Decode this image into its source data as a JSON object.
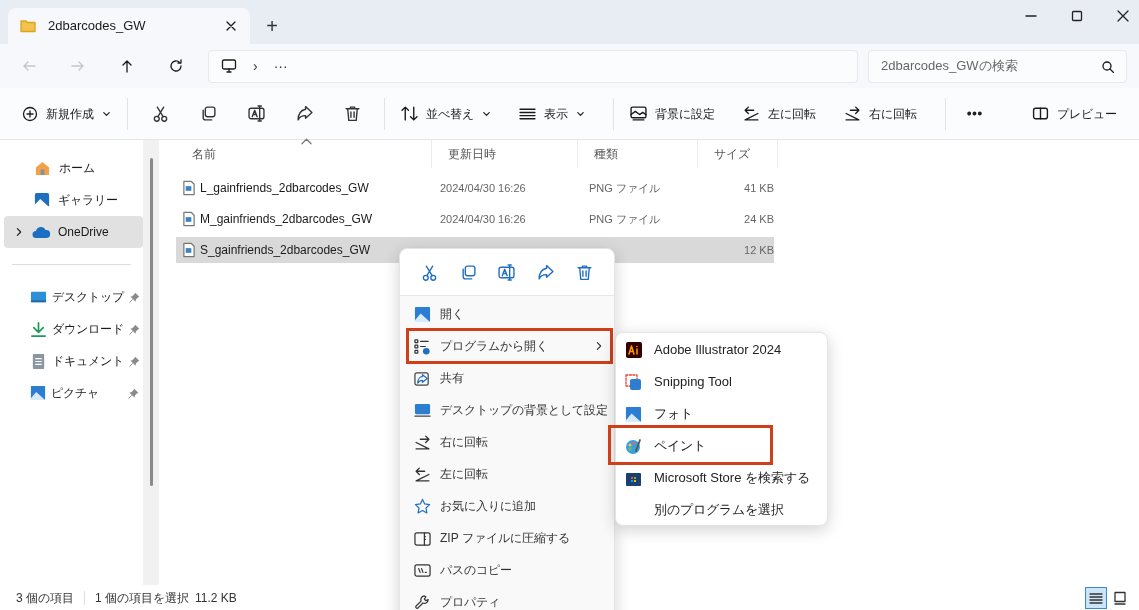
{
  "window": {
    "tab_title": "2dbarcodes_GW",
    "new_tab": "+"
  },
  "nav_buttons": [
    {
      "disabled": true
    },
    {
      "disabled": true
    },
    {
      "disabled": false
    },
    {
      "disabled": false
    }
  ],
  "address": {
    "crumbs": [
      "›",
      "···"
    ]
  },
  "search": {
    "placeholder": "2dbarcodes_GWの検索"
  },
  "toolbar": {
    "new": {
      "label": "新規作成",
      "dropdown": true
    },
    "menus": [
      {
        "label": "並べ替え",
        "dropdown": true
      },
      {
        "label": "表示",
        "dropdown": true
      }
    ],
    "image_actions": [
      {
        "label": "背景に設定"
      },
      {
        "label": "左に回転"
      },
      {
        "label": "右に回転"
      }
    ],
    "preview": "プレビュー"
  },
  "sidebar": {
    "top": [
      {
        "label": "ホーム",
        "selected": false,
        "expandable": false
      },
      {
        "label": "ギャラリー",
        "selected": false,
        "expandable": false
      },
      {
        "label": "OneDrive",
        "selected": true,
        "expandable": true
      }
    ],
    "pinned": [
      {
        "label": "デスクトップ",
        "pinned": true
      },
      {
        "label": "ダウンロード",
        "pinned": true
      },
      {
        "label": "ドキュメント",
        "pinned": true
      },
      {
        "label": "ピクチャ",
        "pinned": true
      }
    ]
  },
  "file_list": {
    "columns": [
      {
        "label": "名前",
        "sorted": true
      },
      {
        "label": "更新日時",
        "sorted": false
      },
      {
        "label": "種類",
        "sorted": false
      },
      {
        "label": "サイズ",
        "sorted": false
      }
    ],
    "rows": [
      {
        "name": "L_gainfriends_2dbarcodes_GW",
        "modified": "2024/04/30 16:26",
        "type": "PNG ファイル",
        "size": "41 KB",
        "selected": false
      },
      {
        "name": "M_gainfriends_2dbarcodes_GW",
        "modified": "2024/04/30 16:26",
        "type": "PNG ファイル",
        "size": "24 KB",
        "selected": false
      },
      {
        "name": "S_gainfriends_2dbarcodes_GW",
        "size": "12 KB",
        "selected": true
      }
    ]
  },
  "context_menu": {
    "items": [
      {
        "label": "開く",
        "highlighted": false,
        "submenu": false
      },
      {
        "label": "プログラムから開く",
        "highlighted": true,
        "submenu": true
      },
      {
        "label": "共有",
        "highlighted": false,
        "submenu": false
      },
      {
        "label": "デスクトップの背景として設定",
        "highlighted": false,
        "submenu": false
      },
      {
        "label": "右に回転",
        "highlighted": false,
        "submenu": false
      },
      {
        "label": "左に回転",
        "highlighted": false,
        "submenu": false
      },
      {
        "label": "お気に入りに追加",
        "highlighted": false,
        "submenu": false
      },
      {
        "label": "ZIP ファイルに圧縮する",
        "highlighted": false,
        "submenu": false
      },
      {
        "label": "パスのコピー",
        "highlighted": false,
        "submenu": false
      },
      {
        "label": "プロパティ",
        "highlighted": false,
        "submenu": false
      }
    ],
    "submenu_items": [
      {
        "label": "Adobe Illustrator 2024",
        "highlighted": false
      },
      {
        "label": "Snipping Tool",
        "highlighted": false
      },
      {
        "label": "フォト",
        "highlighted": false
      },
      {
        "label": "ペイント",
        "highlighted": true
      },
      {
        "label": "Microsoft Store を検索する",
        "highlighted": false
      },
      {
        "label": "別のプログラムを選択",
        "highlighted": false
      }
    ]
  },
  "status_bar": {
    "item_count": "3 個の項目",
    "selection": "1 個の項目を選択",
    "selection_size": "11.2 KB"
  },
  "view_buttons": [
    {
      "selected": true
    },
    {
      "selected": false
    }
  ]
}
